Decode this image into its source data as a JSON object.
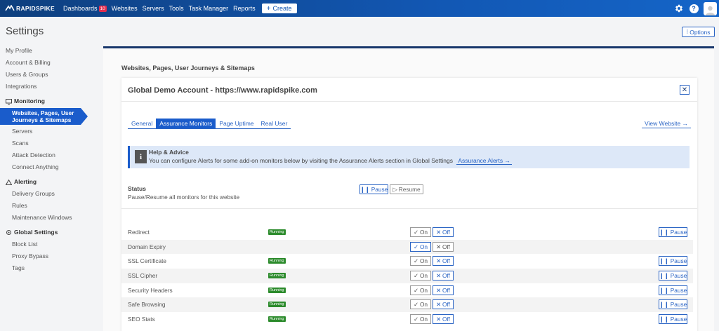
{
  "header": {
    "logo_text": "RAPIDSPIKE",
    "nav": [
      {
        "label": "Dashboards",
        "badge": "10"
      },
      {
        "label": "Websites"
      },
      {
        "label": "Servers"
      },
      {
        "label": "Tools"
      },
      {
        "label": "Task Manager"
      },
      {
        "label": "Reports"
      }
    ],
    "create_label": "Create",
    "help_glyph": "?"
  },
  "page": {
    "title": "Settings",
    "options_label": "Options"
  },
  "sidebar": {
    "top_links": [
      "My Profile",
      "Account & Billing",
      "Users & Groups",
      "Integrations"
    ],
    "monitoring": {
      "title": "Monitoring",
      "active": "Websites, Pages, User Journeys & Sitemaps",
      "items": [
        "Servers",
        "Scans",
        "Attack Detection",
        "Connect Anything"
      ]
    },
    "alerting": {
      "title": "Alerting",
      "items": [
        "Delivery Groups",
        "Rules",
        "Maintenance Windows"
      ]
    },
    "global": {
      "title": "Global Settings",
      "items": [
        "Block List",
        "Proxy Bypass",
        "Tags"
      ]
    }
  },
  "main": {
    "section_heading": "Websites, Pages, User Journeys & Sitemaps",
    "card_title": "Global Demo Account - https://www.rapidspike.com",
    "close_glyph": "✕",
    "tabs": [
      {
        "label": "General",
        "active": false
      },
      {
        "label": "Assurance Monitors",
        "active": true
      },
      {
        "label": "Page Uptime",
        "active": false
      },
      {
        "label": "Real User",
        "active": false
      }
    ],
    "view_website": "View Website →",
    "help": {
      "icon_glyph": "i",
      "title": "Help & Advice",
      "text": "You can configure Alerts for some add-on monitors below by visiting the Assurance Alerts section in Global Settings",
      "link": "Assurance Alerts →"
    },
    "status": {
      "label": "Status",
      "description": "Pause/Resume all monitors for this website",
      "pause_label": "Pause",
      "resume_label": "Resume"
    },
    "monitors": [
      {
        "name": "Redirect",
        "status": "Running",
        "on": "On",
        "off": "Off",
        "pause": "Pause",
        "enabled": "off"
      },
      {
        "name": "Domain Expiry",
        "status": "",
        "on": "On",
        "off": "Off",
        "pause": "",
        "enabled": "on"
      },
      {
        "name": "SSL Certificate",
        "status": "Running",
        "on": "On",
        "off": "Off",
        "pause": "Pause",
        "enabled": "off"
      },
      {
        "name": "SSL Cipher",
        "status": "Running",
        "on": "On",
        "off": "Off",
        "pause": "Pause",
        "enabled": "off"
      },
      {
        "name": "Security Headers",
        "status": "Running",
        "on": "On",
        "off": "Off",
        "pause": "Pause",
        "enabled": "off"
      },
      {
        "name": "Safe Browsing",
        "status": "Running",
        "on": "On",
        "off": "Off",
        "pause": "Pause",
        "enabled": "off"
      },
      {
        "name": "SEO Stats",
        "status": "Running",
        "on": "On",
        "off": "Off",
        "pause": "Pause",
        "enabled": "off"
      }
    ]
  },
  "colors": {
    "brand_blue": "#1257b3",
    "accent_blue": "#1a5ccb",
    "running_green": "#2c8b2c",
    "badge_red": "#e32d4f"
  }
}
